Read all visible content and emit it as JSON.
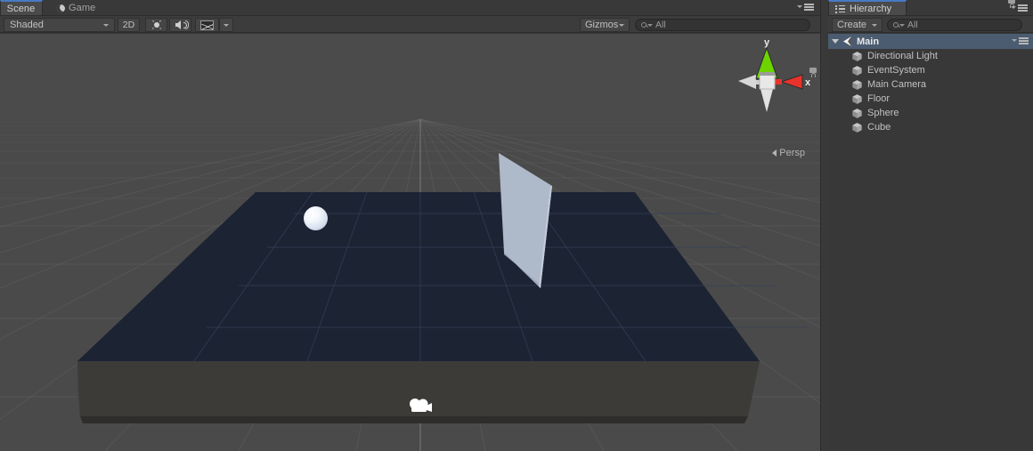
{
  "scene_panel": {
    "tabs": [
      {
        "label": "Scene",
        "icon": "scene-icon",
        "active": true
      },
      {
        "label": "Game",
        "icon": "moon-icon",
        "active": false
      }
    ],
    "menu_icon": "hamburger-menu-icon",
    "toolbar": {
      "shading_mode": "Shaded",
      "two_d_label": "2D",
      "light_toggle_icon": "sun-icon",
      "audio_toggle_icon": "speaker-icon",
      "fx_icon": "image-effects-icon",
      "fx_dropdown_icon": "chevron-down-icon",
      "gizmos_label": "Gizmos",
      "search_placeholder": "All",
      "search_value": "",
      "search_icon": "search-icon"
    },
    "viewport": {
      "projection_label": "Persp",
      "projection_arrow_icon": "left-arrow-icon",
      "lock_icon": "lock-icon",
      "gizmo_axes": [
        {
          "axis": "y",
          "label": "y",
          "color": "#6dd400"
        },
        {
          "axis": "x",
          "label": "x",
          "color": "#e8332a"
        },
        {
          "axis": "z",
          "label": "",
          "color": "#e6e6e6"
        }
      ],
      "objects": [
        {
          "name": "Sphere",
          "kind": "sphere",
          "color": "#e8eef8"
        },
        {
          "name": "Cube",
          "kind": "quad",
          "color": "#aab6c6"
        },
        {
          "name": "Floor",
          "kind": "slab",
          "top_color": "#1d2435",
          "side_color": "#3f3d3a"
        },
        {
          "name": "Main Camera",
          "kind": "camera-gizmo",
          "color": "#ffffff"
        }
      ],
      "grid_color": "#5a5a5a",
      "background_color": "#4a4a4a"
    }
  },
  "hierarchy_panel": {
    "tab_label": "Hierarchy",
    "tab_icon": "hierarchy-list-icon",
    "lock_icon": "lock-icon",
    "menu_icon": "hamburger-menu-icon",
    "create_label": "Create",
    "create_caret_icon": "chevron-down-icon",
    "search_placeholder": "All",
    "search_value": "",
    "search_icon": "search-icon",
    "scene": {
      "name": "Main",
      "expanded": true,
      "expand_icon": "triangle-down-icon",
      "scene_icon": "unity-scene-icon",
      "row_menu_icon": "hamburger-menu-icon"
    },
    "objects": [
      {
        "label": "Directional Light",
        "icon": "gameobject-cube-icon"
      },
      {
        "label": "EventSystem",
        "icon": "gameobject-cube-icon"
      },
      {
        "label": "Main Camera",
        "icon": "gameobject-cube-icon"
      },
      {
        "label": "Floor",
        "icon": "gameobject-cube-icon"
      },
      {
        "label": "Sphere",
        "icon": "gameobject-cube-icon"
      },
      {
        "label": "Cube",
        "icon": "gameobject-cube-icon"
      }
    ]
  },
  "colors": {
    "panel_bg": "#383838",
    "toolbar_bg": "#3c3c3c",
    "tab_active_bg": "#4a4a4a",
    "tab_accent": "#4779c4",
    "scene_row_bg": "#4b5c70",
    "viewport_bg": "#4a4a4a",
    "text": "#c2c2c2"
  }
}
